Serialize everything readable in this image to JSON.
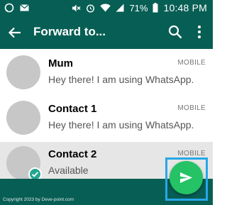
{
  "status_bar": {
    "battery": "71%",
    "time": "10:48 PM"
  },
  "app_bar": {
    "title": "Forward to..."
  },
  "contacts": [
    {
      "name": "Mum",
      "status": "Hey there! I am using WhatsApp.",
      "type": "MOBILE",
      "selected": false
    },
    {
      "name": "Contact 1",
      "status": "Hey there! I am using WhatsApp.",
      "type": "MOBILE",
      "selected": false
    },
    {
      "name": "Contact 2",
      "status": "Available",
      "type": "MOBILE",
      "selected": true
    }
  ],
  "footer": {
    "credit": "Copyright 2023 by Deve-point.com"
  },
  "colors": {
    "primary": "#075e54",
    "fab": "#25c366",
    "check": "#24a690",
    "highlight": "#27a7e8"
  },
  "icons": [
    "whatsapp-icon",
    "email-icon",
    "mute-icon",
    "alarm-icon",
    "wifi-icon",
    "signal-icon",
    "battery-icon",
    "back-arrow-icon",
    "search-icon",
    "more-vert-icon",
    "check-icon",
    "send-icon"
  ]
}
